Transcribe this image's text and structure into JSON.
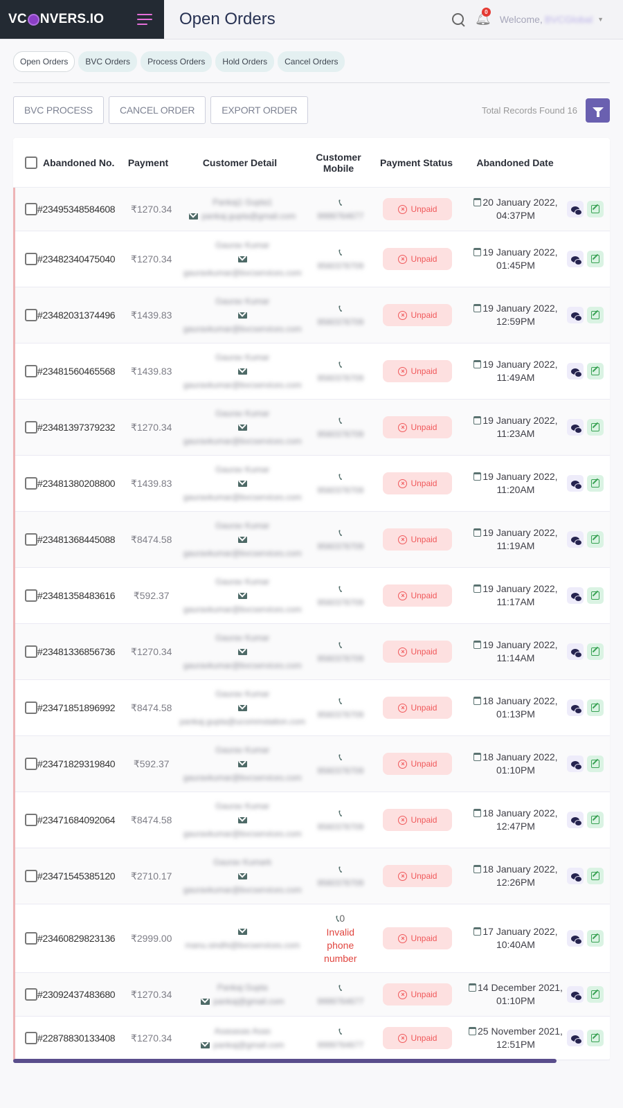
{
  "app": {
    "logo": "VCONVERS.IO",
    "logo_parts": [
      "VC",
      "NVERS.IO"
    ]
  },
  "header": {
    "title": "Open Orders",
    "notifications_count": "0",
    "welcome_label": "Welcome,",
    "username": "BVCGlobal"
  },
  "tabs": [
    {
      "label": "Open Orders",
      "active": true
    },
    {
      "label": "BVC Orders"
    },
    {
      "label": "Process Orders"
    },
    {
      "label": "Hold Orders"
    },
    {
      "label": "Cancel Orders"
    }
  ],
  "toolbar": {
    "bvc_process": "BVC PROCESS",
    "cancel_order": "CANCEL ORDER",
    "export_order": "EXPORT ORDER",
    "total_records": "Total Records Found 16"
  },
  "table": {
    "columns": [
      "Abandoned No.",
      "Payment",
      "Customer Detail",
      "Customer Mobile",
      "Payment Status",
      "Abandoned Date"
    ],
    "column_mobile_line1": "Customer",
    "column_mobile_line2": "Mobile",
    "rows": [
      {
        "order": "#23495348584608",
        "payment": "₹1270.34",
        "name": "Pankaj1 Gupta1",
        "email": "pankaj.gupta@gmail.com",
        "mobile": "9999764677",
        "status": "Unpaid",
        "date": "20 January 2022,",
        "time": "04:37PM"
      },
      {
        "order": "#23482340475040",
        "payment": "₹1270.34",
        "name": "Gaurav Kumar",
        "email": "gauravkumar@bvcservices.com",
        "mobile": "9560378709",
        "status": "Unpaid",
        "date": "19 January 2022,",
        "time": "01:45PM"
      },
      {
        "order": "#23482031374496",
        "payment": "₹1439.83",
        "name": "Gaurav Kumar",
        "email": "gauravkumar@bvcservices.com",
        "mobile": "9560378709",
        "status": "Unpaid",
        "date": "19 January 2022,",
        "time": "12:59PM"
      },
      {
        "order": "#23481560465568",
        "payment": "₹1439.83",
        "name": "Gaurav Kumar",
        "email": "gauravkumar@bvcservices.com",
        "mobile": "9560378709",
        "status": "Unpaid",
        "date": "19 January 2022,",
        "time": "11:49AM"
      },
      {
        "order": "#23481397379232",
        "payment": "₹1270.34",
        "name": "Gaurav Kumar",
        "email": "gauravkumar@bvcservices.com",
        "mobile": "9560378709",
        "status": "Unpaid",
        "date": "19 January 2022,",
        "time": "11:23AM"
      },
      {
        "order": "#23481380208800",
        "payment": "₹1439.83",
        "name": "Gaurav Kumar",
        "email": "gauravkumar@bvcservices.com",
        "mobile": "9560378709",
        "status": "Unpaid",
        "date": "19 January 2022,",
        "time": "11:20AM"
      },
      {
        "order": "#23481368445088",
        "payment": "₹8474.58",
        "name": "Gaurav Kumar",
        "email": "gauravkumar@bvcservices.com",
        "mobile": "9560378709",
        "status": "Unpaid",
        "date": "19 January 2022,",
        "time": "11:19AM"
      },
      {
        "order": "#23481358483616",
        "payment": "₹592.37",
        "name": "Gaurav Kumar",
        "email": "gauravkumar@bvcservices.com",
        "mobile": "9560378709",
        "status": "Unpaid",
        "date": "19 January 2022,",
        "time": "11:17AM"
      },
      {
        "order": "#23481336856736",
        "payment": "₹1270.34",
        "name": "Gaurav Kumar",
        "email": "gauravkumar@bvcservices.com",
        "mobile": "9560378709",
        "status": "Unpaid",
        "date": "19 January 2022,",
        "time": "11:14AM"
      },
      {
        "order": "#23471851896992",
        "payment": "₹8474.58",
        "name": "Gaurav Kumar",
        "email": "pankaj.gupta@ucommstation.com",
        "mobile": "9560378709",
        "status": "Unpaid",
        "date": "18 January 2022,",
        "time": "01:13PM"
      },
      {
        "order": "#23471829319840",
        "payment": "₹592.37",
        "name": "Gaurav Kumar",
        "email": "gauravkumar@bvcservices.com",
        "mobile": "9560378709",
        "status": "Unpaid",
        "date": "18 January 2022,",
        "time": "01:10PM"
      },
      {
        "order": "#23471684092064",
        "payment": "₹8474.58",
        "name": "Gaurav Kumar",
        "email": "gauravkumar@bvcservices.com",
        "mobile": "9560378709",
        "status": "Unpaid",
        "date": "18 January 2022,",
        "time": "12:47PM"
      },
      {
        "order": "#23471545385120",
        "payment": "₹2710.17",
        "name": "Gaurav Kumark",
        "email": "gauravkumar@bvcservices.com",
        "mobile": "9560378709",
        "status": "Unpaid",
        "date": "18 January 2022,",
        "time": "12:26PM"
      },
      {
        "order": "#23460829823136",
        "payment": "₹2999.00",
        "name": "",
        "email": "manu.sindhi@bvcservices.com",
        "mobile": "0",
        "mobile_error": [
          "Invalid",
          "phone",
          "number"
        ],
        "status": "Unpaid",
        "date": "17 January 2022,",
        "time": "10:40AM"
      },
      {
        "order": "#23092437483680",
        "payment": "₹1270.34",
        "name": "Pankaj Gupta",
        "email": "pankaj@gmail.com",
        "mobile": "9999764677",
        "status": "Unpaid",
        "date": "14 December 2021,",
        "time": "01:10PM"
      },
      {
        "order": "#22878830133408",
        "payment": "₹1270.34",
        "name": "Asasasas Asas",
        "email": "pankaj@gmail.com",
        "mobile": "9999764677",
        "status": "Unpaid",
        "date": "25 November 2021,",
        "time": "12:51PM"
      }
    ]
  },
  "colors": {
    "sidebar_bg": "#232a33",
    "accent": "#6a60b0",
    "unpaid_bg": "#fde0e0",
    "unpaid_text": "#f0585a",
    "hamburger": "#e46fd9"
  }
}
